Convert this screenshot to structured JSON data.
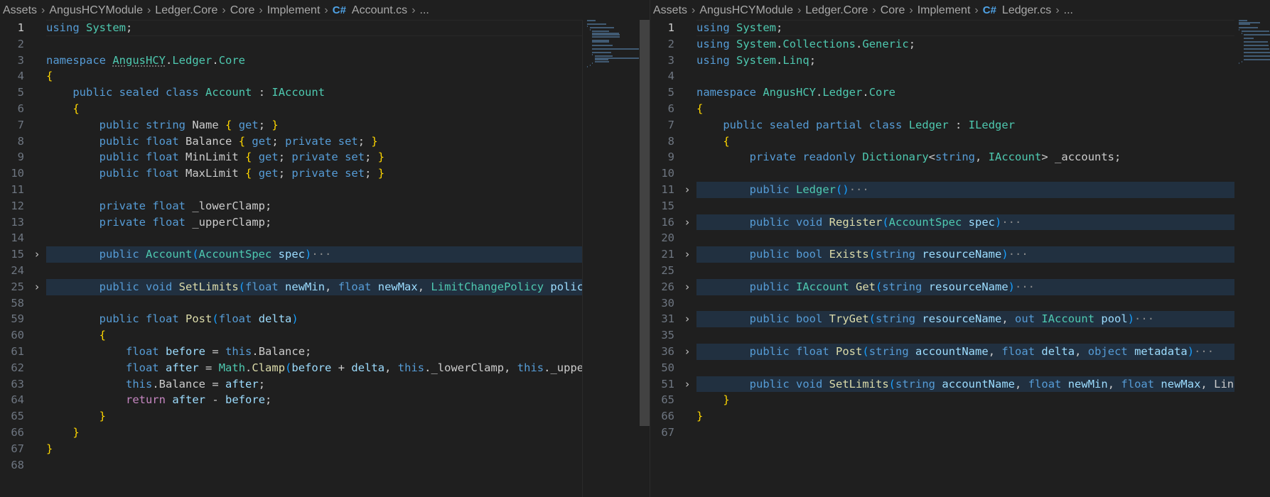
{
  "left": {
    "breadcrumb": [
      "Assets",
      "AngusHCYModule",
      "Ledger.Core",
      "Core",
      "Implement"
    ],
    "file_icon": "C#",
    "file": "Account.cs",
    "trail": "...",
    "lines": [
      {
        "n": "1",
        "active": true
      },
      {
        "n": "2"
      },
      {
        "n": "3"
      },
      {
        "n": "4"
      },
      {
        "n": "5"
      },
      {
        "n": "6"
      },
      {
        "n": "7"
      },
      {
        "n": "8"
      },
      {
        "n": "9"
      },
      {
        "n": "10"
      },
      {
        "n": "11"
      },
      {
        "n": "12"
      },
      {
        "n": "13"
      },
      {
        "n": "14"
      },
      {
        "n": "15",
        "fold": true
      },
      {
        "n": "24"
      },
      {
        "n": "25",
        "fold": true
      },
      {
        "n": "58"
      },
      {
        "n": "59"
      },
      {
        "n": "60"
      },
      {
        "n": "61"
      },
      {
        "n": "62"
      },
      {
        "n": "63"
      },
      {
        "n": "64"
      },
      {
        "n": "65"
      },
      {
        "n": "66"
      },
      {
        "n": "67"
      },
      {
        "n": "68"
      }
    ],
    "code": [
      "using System;",
      "",
      "namespace AngusHCY.Ledger.Core",
      "{",
      "    public sealed class Account : IAccount",
      "    {",
      "        public string Name { get; }",
      "        public float Balance { get; private set; }",
      "        public float MinLimit { get; private set; }",
      "        public float MaxLimit { get; private set; }",
      "",
      "        private float _lowerClamp;",
      "        private float _upperClamp;",
      "",
      "        public Account(AccountSpec spec)",
      "",
      "        public void SetLimits(float newMin, float newMax, LimitChangePolicy polic",
      "",
      "        public float Post(float delta)",
      "        {",
      "            float before = this.Balance;",
      "            float after = Math.Clamp(before + delta, this._lowerClamp, this._uppe",
      "            this.Balance = after;",
      "            return after - before;",
      "        }",
      "    }",
      "}",
      ""
    ]
  },
  "right": {
    "breadcrumb": [
      "Assets",
      "AngusHCYModule",
      "Ledger.Core",
      "Core",
      "Implement"
    ],
    "file_icon": "C#",
    "file": "Ledger.cs",
    "trail": "...",
    "lines": [
      {
        "n": "1",
        "active": true
      },
      {
        "n": "2"
      },
      {
        "n": "3"
      },
      {
        "n": "4"
      },
      {
        "n": "5"
      },
      {
        "n": "6"
      },
      {
        "n": "7"
      },
      {
        "n": "8"
      },
      {
        "n": "9"
      },
      {
        "n": "10"
      },
      {
        "n": "11",
        "fold": true
      },
      {
        "n": "15"
      },
      {
        "n": "16",
        "fold": true
      },
      {
        "n": "20"
      },
      {
        "n": "21",
        "fold": true
      },
      {
        "n": "25"
      },
      {
        "n": "26",
        "fold": true
      },
      {
        "n": "30"
      },
      {
        "n": "31",
        "fold": true
      },
      {
        "n": "35"
      },
      {
        "n": "36",
        "fold": true
      },
      {
        "n": "50"
      },
      {
        "n": "51",
        "fold": true
      },
      {
        "n": "65"
      },
      {
        "n": "66"
      },
      {
        "n": "67"
      }
    ],
    "code": [
      "using System;",
      "using System.Collections.Generic;",
      "using System.Linq;",
      "",
      "namespace AngusHCY.Ledger.Core",
      "{",
      "    public sealed partial class Ledger : ILedger",
      "    {",
      "        private readonly Dictionary<string, IAccount> _accounts;",
      "",
      "        public Ledger()",
      "",
      "        public void Register(AccountSpec spec)",
      "",
      "        public bool Exists(string resourceName)",
      "",
      "        public IAccount Get(string resourceName)",
      "",
      "        public bool TryGet(string resourceName, out IAccount pool)",
      "",
      "        public float Post(string accountName, float delta, object metadata)",
      "",
      "        public void SetLimits(string accountName, float newMin, float newMax, Lin",
      "    }",
      "}",
      ""
    ]
  },
  "fold_ellipsis": "···",
  "fold_icon": "chevron-right-icon",
  "colors": {
    "background": "#1f1f1f",
    "keyword": "#569cd6",
    "control": "#c586c0",
    "type": "#4ec9b0",
    "function": "#dcdcaa",
    "variable": "#9cdcfe",
    "folded_line_bg": "#213040"
  }
}
